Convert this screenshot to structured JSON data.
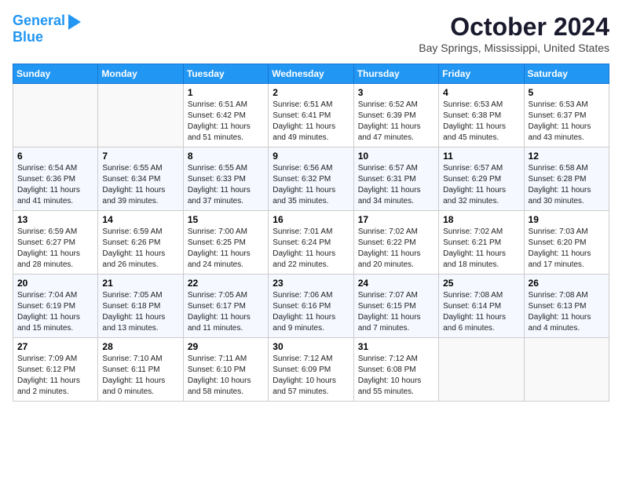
{
  "logo": {
    "line1": "General",
    "line2": "Blue"
  },
  "title": "October 2024",
  "location": "Bay Springs, Mississippi, United States",
  "weekdays": [
    "Sunday",
    "Monday",
    "Tuesday",
    "Wednesday",
    "Thursday",
    "Friday",
    "Saturday"
  ],
  "weeks": [
    [
      {
        "day": "",
        "info": ""
      },
      {
        "day": "",
        "info": ""
      },
      {
        "day": "1",
        "info": "Sunrise: 6:51 AM\nSunset: 6:42 PM\nDaylight: 11 hours and 51 minutes."
      },
      {
        "day": "2",
        "info": "Sunrise: 6:51 AM\nSunset: 6:41 PM\nDaylight: 11 hours and 49 minutes."
      },
      {
        "day": "3",
        "info": "Sunrise: 6:52 AM\nSunset: 6:39 PM\nDaylight: 11 hours and 47 minutes."
      },
      {
        "day": "4",
        "info": "Sunrise: 6:53 AM\nSunset: 6:38 PM\nDaylight: 11 hours and 45 minutes."
      },
      {
        "day": "5",
        "info": "Sunrise: 6:53 AM\nSunset: 6:37 PM\nDaylight: 11 hours and 43 minutes."
      }
    ],
    [
      {
        "day": "6",
        "info": "Sunrise: 6:54 AM\nSunset: 6:36 PM\nDaylight: 11 hours and 41 minutes."
      },
      {
        "day": "7",
        "info": "Sunrise: 6:55 AM\nSunset: 6:34 PM\nDaylight: 11 hours and 39 minutes."
      },
      {
        "day": "8",
        "info": "Sunrise: 6:55 AM\nSunset: 6:33 PM\nDaylight: 11 hours and 37 minutes."
      },
      {
        "day": "9",
        "info": "Sunrise: 6:56 AM\nSunset: 6:32 PM\nDaylight: 11 hours and 35 minutes."
      },
      {
        "day": "10",
        "info": "Sunrise: 6:57 AM\nSunset: 6:31 PM\nDaylight: 11 hours and 34 minutes."
      },
      {
        "day": "11",
        "info": "Sunrise: 6:57 AM\nSunset: 6:29 PM\nDaylight: 11 hours and 32 minutes."
      },
      {
        "day": "12",
        "info": "Sunrise: 6:58 AM\nSunset: 6:28 PM\nDaylight: 11 hours and 30 minutes."
      }
    ],
    [
      {
        "day": "13",
        "info": "Sunrise: 6:59 AM\nSunset: 6:27 PM\nDaylight: 11 hours and 28 minutes."
      },
      {
        "day": "14",
        "info": "Sunrise: 6:59 AM\nSunset: 6:26 PM\nDaylight: 11 hours and 26 minutes."
      },
      {
        "day": "15",
        "info": "Sunrise: 7:00 AM\nSunset: 6:25 PM\nDaylight: 11 hours and 24 minutes."
      },
      {
        "day": "16",
        "info": "Sunrise: 7:01 AM\nSunset: 6:24 PM\nDaylight: 11 hours and 22 minutes."
      },
      {
        "day": "17",
        "info": "Sunrise: 7:02 AM\nSunset: 6:22 PM\nDaylight: 11 hours and 20 minutes."
      },
      {
        "day": "18",
        "info": "Sunrise: 7:02 AM\nSunset: 6:21 PM\nDaylight: 11 hours and 18 minutes."
      },
      {
        "day": "19",
        "info": "Sunrise: 7:03 AM\nSunset: 6:20 PM\nDaylight: 11 hours and 17 minutes."
      }
    ],
    [
      {
        "day": "20",
        "info": "Sunrise: 7:04 AM\nSunset: 6:19 PM\nDaylight: 11 hours and 15 minutes."
      },
      {
        "day": "21",
        "info": "Sunrise: 7:05 AM\nSunset: 6:18 PM\nDaylight: 11 hours and 13 minutes."
      },
      {
        "day": "22",
        "info": "Sunrise: 7:05 AM\nSunset: 6:17 PM\nDaylight: 11 hours and 11 minutes."
      },
      {
        "day": "23",
        "info": "Sunrise: 7:06 AM\nSunset: 6:16 PM\nDaylight: 11 hours and 9 minutes."
      },
      {
        "day": "24",
        "info": "Sunrise: 7:07 AM\nSunset: 6:15 PM\nDaylight: 11 hours and 7 minutes."
      },
      {
        "day": "25",
        "info": "Sunrise: 7:08 AM\nSunset: 6:14 PM\nDaylight: 11 hours and 6 minutes."
      },
      {
        "day": "26",
        "info": "Sunrise: 7:08 AM\nSunset: 6:13 PM\nDaylight: 11 hours and 4 minutes."
      }
    ],
    [
      {
        "day": "27",
        "info": "Sunrise: 7:09 AM\nSunset: 6:12 PM\nDaylight: 11 hours and 2 minutes."
      },
      {
        "day": "28",
        "info": "Sunrise: 7:10 AM\nSunset: 6:11 PM\nDaylight: 11 hours and 0 minutes."
      },
      {
        "day": "29",
        "info": "Sunrise: 7:11 AM\nSunset: 6:10 PM\nDaylight: 10 hours and 58 minutes."
      },
      {
        "day": "30",
        "info": "Sunrise: 7:12 AM\nSunset: 6:09 PM\nDaylight: 10 hours and 57 minutes."
      },
      {
        "day": "31",
        "info": "Sunrise: 7:12 AM\nSunset: 6:08 PM\nDaylight: 10 hours and 55 minutes."
      },
      {
        "day": "",
        "info": ""
      },
      {
        "day": "",
        "info": ""
      }
    ]
  ]
}
